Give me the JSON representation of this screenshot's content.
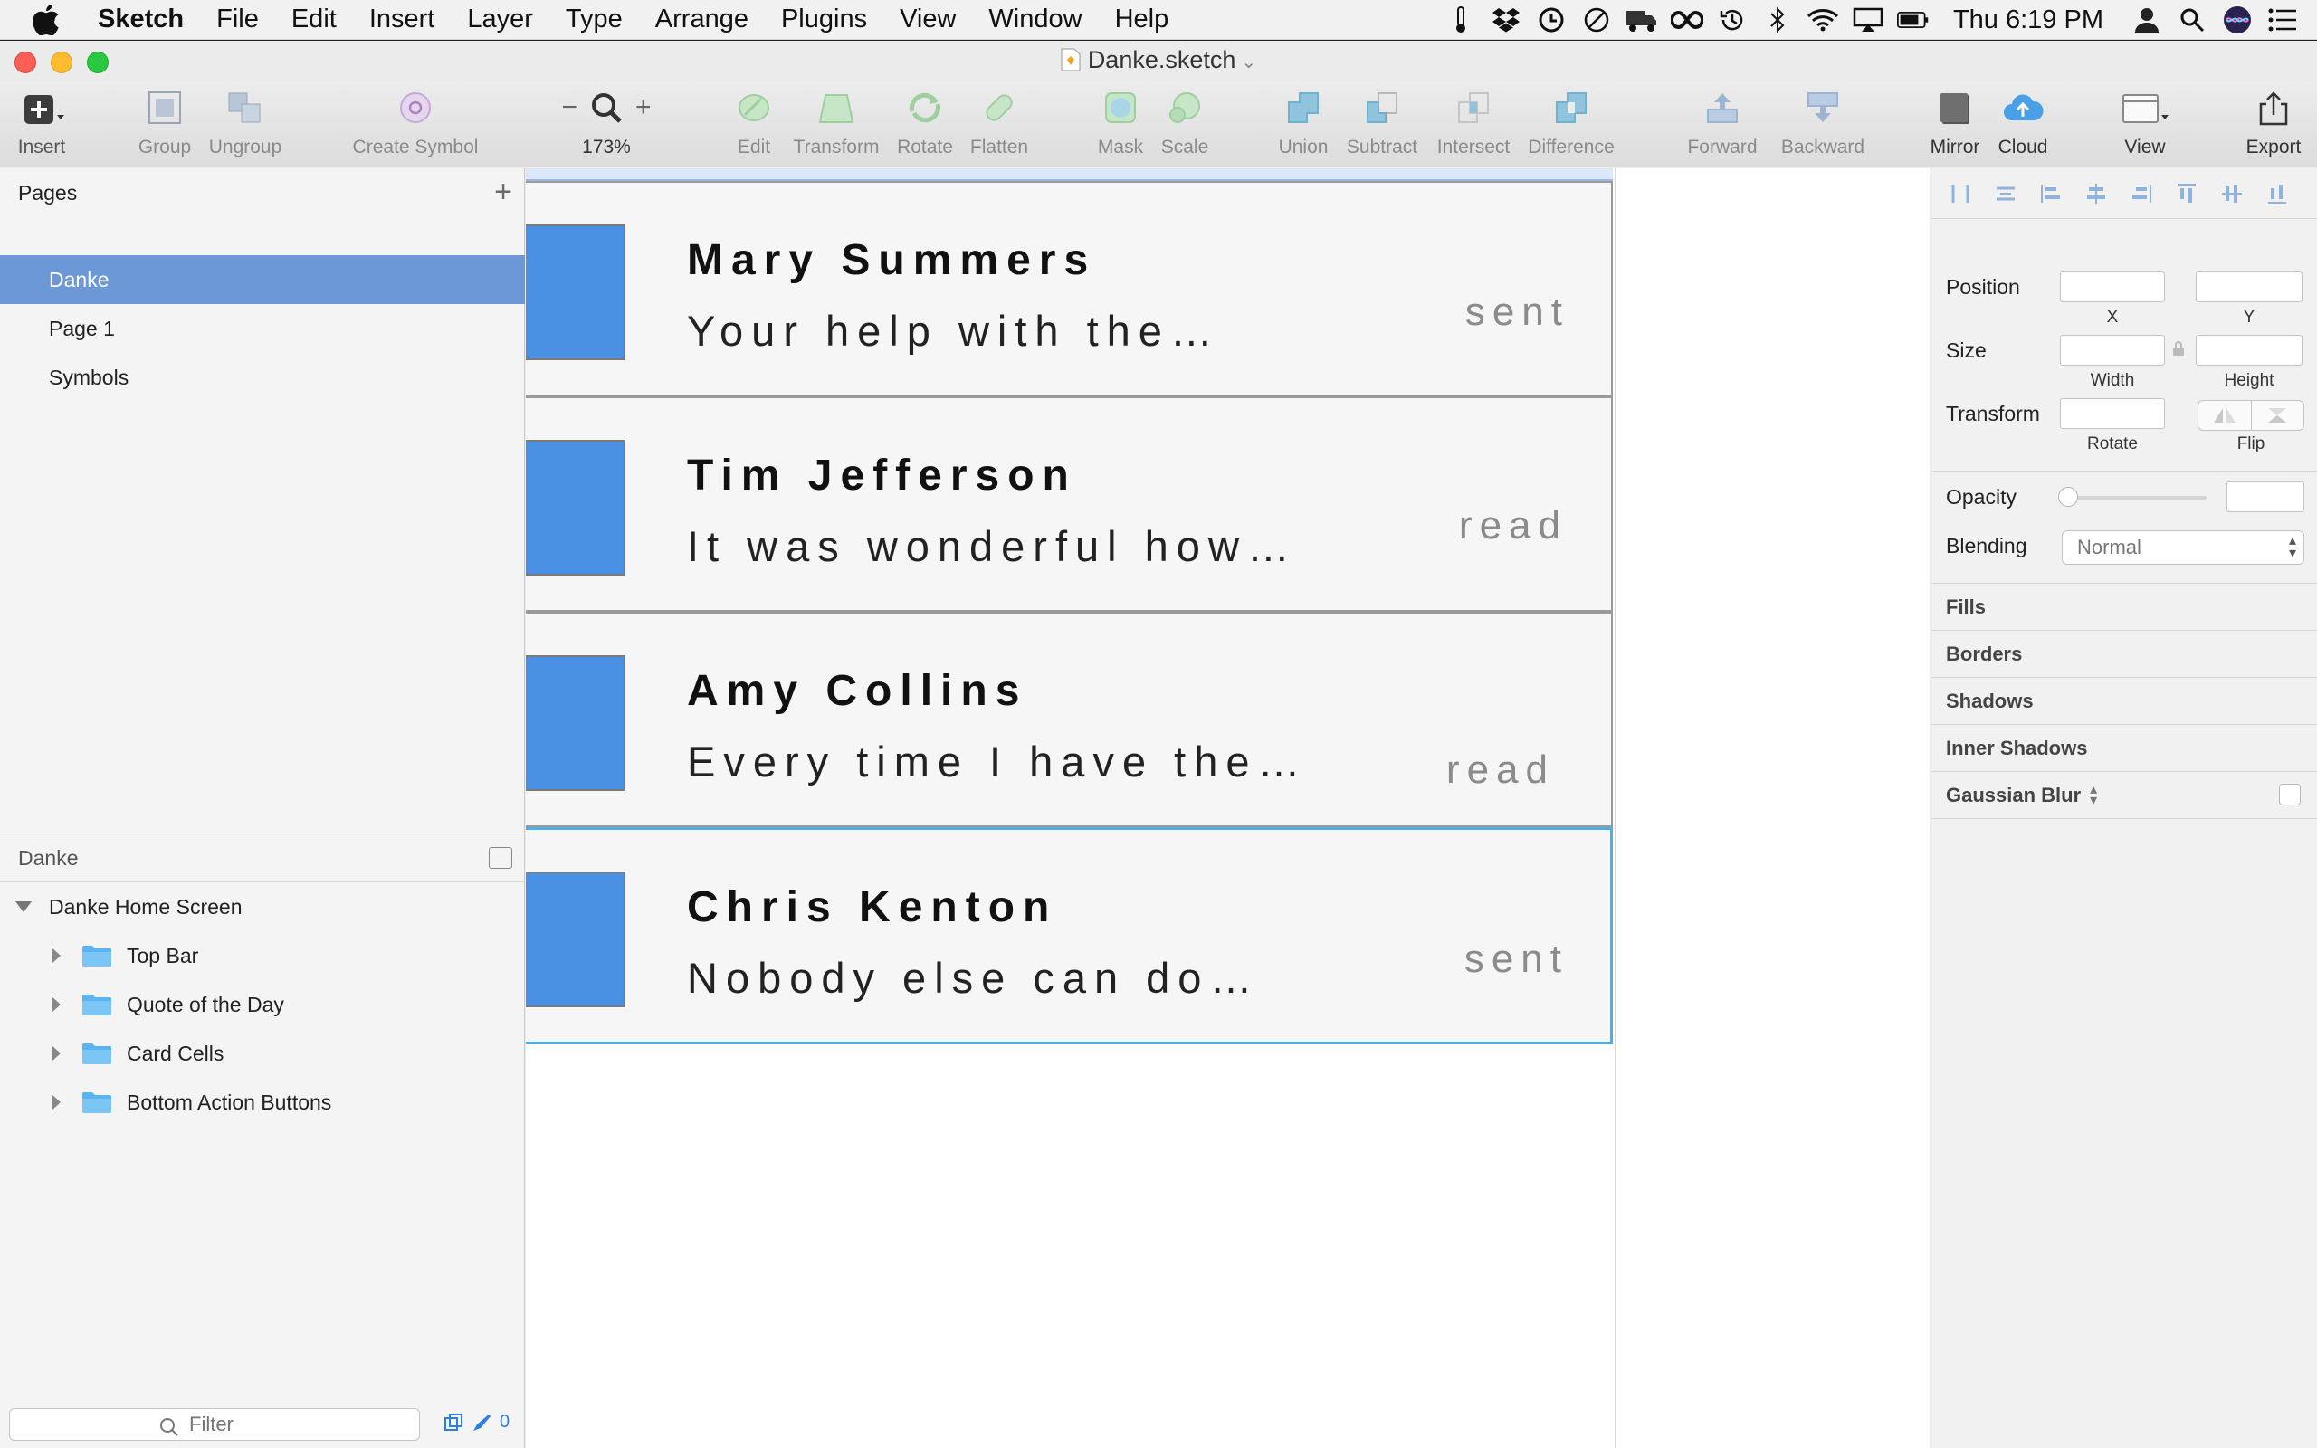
{
  "menubar": {
    "app": "Sketch",
    "items": [
      "File",
      "Edit",
      "Insert",
      "Layer",
      "Type",
      "Arrange",
      "Plugins",
      "View",
      "Window",
      "Help"
    ],
    "clock": "Thu 6:19 PM"
  },
  "window": {
    "title": "Danke.sketch"
  },
  "toolbar": {
    "insert": "Insert",
    "group": "Group",
    "ungroup": "Ungroup",
    "create_symbol": "Create Symbol",
    "zoom": "173%",
    "edit": "Edit",
    "transform": "Transform",
    "rotate": "Rotate",
    "flatten": "Flatten",
    "mask": "Mask",
    "scale": "Scale",
    "union": "Union",
    "subtract": "Subtract",
    "intersect": "Intersect",
    "difference": "Difference",
    "forward": "Forward",
    "backward": "Backward",
    "mirror": "Mirror",
    "cloud": "Cloud",
    "view": "View",
    "export": "Export"
  },
  "pages": {
    "header": "Pages",
    "items": [
      "Danke",
      "Page 1",
      "Symbols"
    ],
    "selected": "Danke"
  },
  "layers": {
    "header": "Danke",
    "root": "Danke Home Screen",
    "groups": [
      "Top Bar",
      "Quote of the Day",
      "Card Cells",
      "Bottom Action Buttons"
    ]
  },
  "filter": {
    "placeholder": "Filter",
    "count": "0"
  },
  "cards": [
    {
      "name": "Mary Summers",
      "preview": "Your help with the…",
      "status": "sent"
    },
    {
      "name": "Tim Jefferson",
      "preview": "It was wonderful how…",
      "status": "read"
    },
    {
      "name": "Amy Collins",
      "preview": "Every time I have the…",
      "status": "read"
    },
    {
      "name": "Chris Kenton",
      "preview": "Nobody else can do…",
      "status": "sent"
    }
  ],
  "inspector": {
    "position": "Position",
    "x": "X",
    "y": "Y",
    "size": "Size",
    "width": "Width",
    "height": "Height",
    "transform": "Transform",
    "rotate": "Rotate",
    "flip": "Flip",
    "opacity": "Opacity",
    "blending": "Blending",
    "blending_value": "Normal",
    "sections": [
      "Fills",
      "Borders",
      "Shadows",
      "Inner Shadows",
      "Gaussian Blur"
    ]
  },
  "colors": {
    "accent": "#4a90e2",
    "selection": "#6d98d7",
    "selected_border": "#4aaee8"
  }
}
